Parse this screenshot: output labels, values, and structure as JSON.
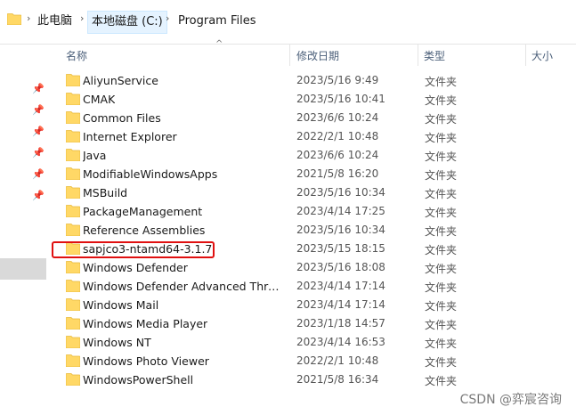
{
  "address": {
    "crumbs": [
      "此电脑",
      "本地磁盘 (C:)",
      "Program Files"
    ],
    "chevron": "›"
  },
  "columns": {
    "name": "名称",
    "date": "修改日期",
    "type": "类型",
    "size": "大小"
  },
  "rows": [
    {
      "name": "AliyunService",
      "date": "2023/5/16 9:49",
      "type": "文件夹"
    },
    {
      "name": "CMAK",
      "date": "2023/5/16 10:41",
      "type": "文件夹"
    },
    {
      "name": "Common Files",
      "date": "2023/6/6 10:24",
      "type": "文件夹"
    },
    {
      "name": "Internet Explorer",
      "date": "2022/2/1 10:48",
      "type": "文件夹"
    },
    {
      "name": "Java",
      "date": "2023/6/6 10:24",
      "type": "文件夹"
    },
    {
      "name": "ModifiableWindowsApps",
      "date": "2021/5/8 16:20",
      "type": "文件夹"
    },
    {
      "name": "MSBuild",
      "date": "2023/5/16 10:34",
      "type": "文件夹"
    },
    {
      "name": "PackageManagement",
      "date": "2023/4/14 17:25",
      "type": "文件夹"
    },
    {
      "name": "Reference Assemblies",
      "date": "2023/5/16 10:34",
      "type": "文件夹"
    },
    {
      "name": "sapjco3-ntamd64-3.1.7",
      "date": "2023/5/15 18:15",
      "type": "文件夹"
    },
    {
      "name": "Windows Defender",
      "date": "2023/5/16 18:08",
      "type": "文件夹"
    },
    {
      "name": "Windows Defender Advanced Threat ...",
      "date": "2023/4/14 17:14",
      "type": "文件夹"
    },
    {
      "name": "Windows Mail",
      "date": "2023/4/14 17:14",
      "type": "文件夹"
    },
    {
      "name": "Windows Media Player",
      "date": "2023/1/18 14:57",
      "type": "文件夹"
    },
    {
      "name": "Windows NT",
      "date": "2023/4/14 16:53",
      "type": "文件夹"
    },
    {
      "name": "Windows Photo Viewer",
      "date": "2022/2/1 10:48",
      "type": "文件夹"
    },
    {
      "name": "WindowsPowerShell",
      "date": "2021/5/8 16:34",
      "type": "文件夹"
    }
  ],
  "watermark": "CSDN @弈宸咨询",
  "colors": {
    "folder": "#ffd866",
    "folder_dark": "#e8b93b",
    "highlight": "#e01010"
  },
  "icons": {
    "folder": "folder-icon",
    "pin": "pin-icon",
    "sort": "sort-up-icon"
  }
}
